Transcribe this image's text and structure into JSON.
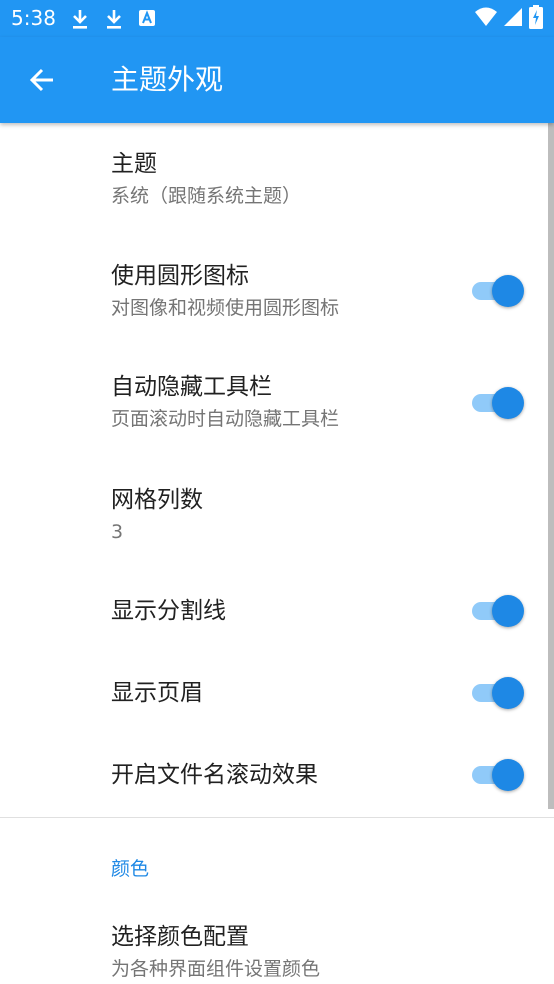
{
  "status_bar": {
    "time": "5:38",
    "notification_icons": [
      "download-icon",
      "download-icon",
      "translate-icon"
    ],
    "system_icons": [
      "wifi-icon",
      "cell-signal-icon",
      "battery-charging-icon"
    ]
  },
  "app_bar": {
    "title": "主题外观",
    "back_icon": "arrow-back-icon",
    "color": "#2196F3"
  },
  "preferences": [
    {
      "title": "主题",
      "summary": "系统（跟随系统主题）",
      "has_switch": false
    },
    {
      "title": "使用圆形图标",
      "summary": "对图像和视频使用圆形图标",
      "has_switch": true,
      "checked": true
    },
    {
      "title": "自动隐藏工具栏",
      "summary": "页面滚动时自动隐藏工具栏",
      "has_switch": true,
      "checked": true
    },
    {
      "title": "网格列数",
      "summary": "3",
      "has_switch": false
    },
    {
      "title": "显示分割线",
      "has_switch": true,
      "checked": true
    },
    {
      "title": "显示页眉",
      "has_switch": true,
      "checked": true
    },
    {
      "title": "开启文件名滚动效果",
      "has_switch": true,
      "checked": true
    }
  ],
  "color_section": {
    "header": "颜色",
    "item": {
      "title": "选择颜色配置",
      "summary": "为各种界面组件设置颜色"
    }
  },
  "colors": {
    "accent": "#1E88E5",
    "switch_track": "#90CAF9",
    "title_text": "#212121",
    "summary_text": "#757575"
  }
}
